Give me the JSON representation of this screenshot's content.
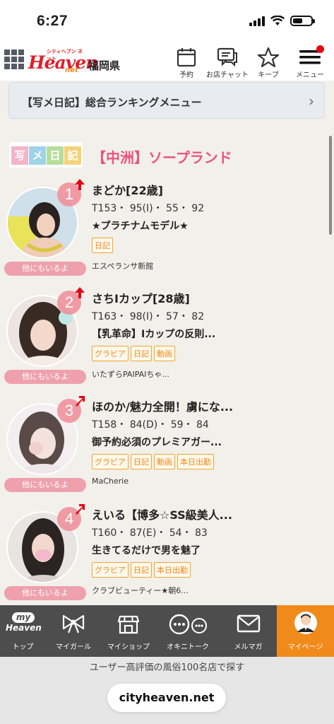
{
  "status_bar": {
    "time": "6:27"
  },
  "header": {
    "logo_small": "シティヘブン ネット",
    "logo_main": "Heaven",
    "logo_net": "net",
    "prefecture": "福岡県",
    "buttons": [
      {
        "label": "予約",
        "icon": "calendar-icon"
      },
      {
        "label": "お店チャット",
        "icon": "chat-icon"
      },
      {
        "label": "キープ",
        "icon": "star-icon"
      },
      {
        "label": "メニュー",
        "icon": "hamburger-icon"
      }
    ]
  },
  "ranking_menu": {
    "label": "【写メ日記】総合ランキングメニュー"
  },
  "section": {
    "logo_chars": [
      "写",
      "メ",
      "日",
      "記"
    ],
    "title": "【中洲】ソープランド"
  },
  "entries": [
    {
      "rank": "1",
      "name": "まどか[22歳]",
      "spec": "T153・ 95(I)・ 55・ 92",
      "catch": "★プラチナムモデル★",
      "tags": [
        "日記"
      ],
      "shop": "エスペランサ新館",
      "others": "他にもいるよ"
    },
    {
      "rank": "2",
      "name": "さちIカップ[28歳]",
      "spec": "T163・ 98(I)・ 57・ 82",
      "catch": "【乳革命】Iカップの反則...",
      "tags": [
        "グラビア",
        "日記",
        "動画"
      ],
      "shop": "いたずらPAIPAIちゃ...",
      "others": "他にもいるよ"
    },
    {
      "rank": "3",
      "name": "ほのか/魅力全開！虜にな...",
      "spec": "T158・ 84(D)・ 59・ 84",
      "catch": "御予約必須のプレミアガー...",
      "tags": [
        "グラビア",
        "日記",
        "動画",
        "本日出勤"
      ],
      "shop": "MaCherie",
      "others": "他にもいるよ"
    },
    {
      "rank": "4",
      "name": "えいる【博多☆SS級美人...",
      "spec": "T160・ 87(E)・ 54・ 83",
      "catch": "生きてるだけで男を魅了",
      "tags": [
        "グラビア",
        "日記",
        "本日出勤"
      ],
      "shop": "クラブビューティー★朝6...",
      "others": "他にもいるよ"
    }
  ],
  "bottom_nav": [
    {
      "label": "トップ",
      "icon": "my-heaven-icon"
    },
    {
      "label": "マイガール",
      "icon": "ribbon-icon"
    },
    {
      "label": "マイショップ",
      "icon": "shop-icon"
    },
    {
      "label": "オキニトーク",
      "icon": "talk-icon"
    },
    {
      "label": "メルマガ",
      "icon": "mail-icon"
    },
    {
      "label": "マイページ",
      "icon": "user-avatar-icon"
    }
  ],
  "my_heaven": {
    "line1": "my",
    "line2": "Heaven"
  },
  "safari": {
    "hint": "ユーザー高評価の風俗100名店で探す",
    "url": "cityheaven.net"
  },
  "colors": {
    "accent": "#f08a1a",
    "pink": "#e9557e",
    "rank_badge": "#f08c96"
  }
}
